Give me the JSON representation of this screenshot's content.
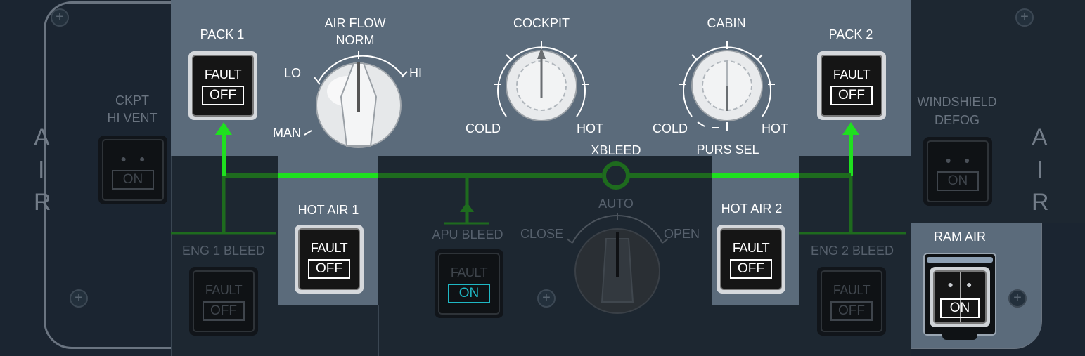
{
  "side_labels": {
    "left": [
      "A",
      "I",
      "R"
    ],
    "right": [
      "A",
      "I",
      "R"
    ]
  },
  "ckpt_hi_vent": {
    "label_line1": "CKPT",
    "label_line2": "HI VENT",
    "state": "ON"
  },
  "pack1": {
    "label": "PACK 1",
    "fault": "FAULT",
    "state": "OFF"
  },
  "pack2": {
    "label": "PACK 2",
    "fault": "FAULT",
    "state": "OFF"
  },
  "air_flow": {
    "label_line1": "AIR FLOW",
    "label_line2": "NORM",
    "lo": "LO",
    "hi": "HI",
    "man": "MAN"
  },
  "cockpit_temp": {
    "label": "COCKPIT",
    "cold": "COLD",
    "hot": "HOT"
  },
  "cabin_temp": {
    "label": "CABIN",
    "cold": "COLD",
    "hot": "HOT",
    "purs_sel": "PURS SEL"
  },
  "xbleed": {
    "label": "XBLEED",
    "auto": "AUTO",
    "close": "CLOSE",
    "open": "OPEN"
  },
  "hot_air1": {
    "label": "HOT AIR 1",
    "fault": "FAULT",
    "state": "OFF"
  },
  "hot_air2": {
    "label": "HOT AIR 2",
    "fault": "FAULT",
    "state": "OFF"
  },
  "apu_bleed": {
    "label": "APU BLEED",
    "fault": "FAULT",
    "state": "ON"
  },
  "eng1_bleed": {
    "label": "ENG 1 BLEED",
    "fault": "FAULT",
    "state": "OFF"
  },
  "eng2_bleed": {
    "label": "ENG 2 BLEED",
    "fault": "FAULT",
    "state": "OFF"
  },
  "windshield_defog": {
    "label_line1": "WINDSHIELD",
    "label_line2": "DEFOG",
    "state": "ON"
  },
  "ram_air": {
    "label": "RAM AIR",
    "state": "ON"
  },
  "colors": {
    "duct_green": "#1fe01f",
    "panel_gray": "#5b6b7b",
    "dark_panel": "#1b2531",
    "cyan": "#1fb8c4"
  }
}
